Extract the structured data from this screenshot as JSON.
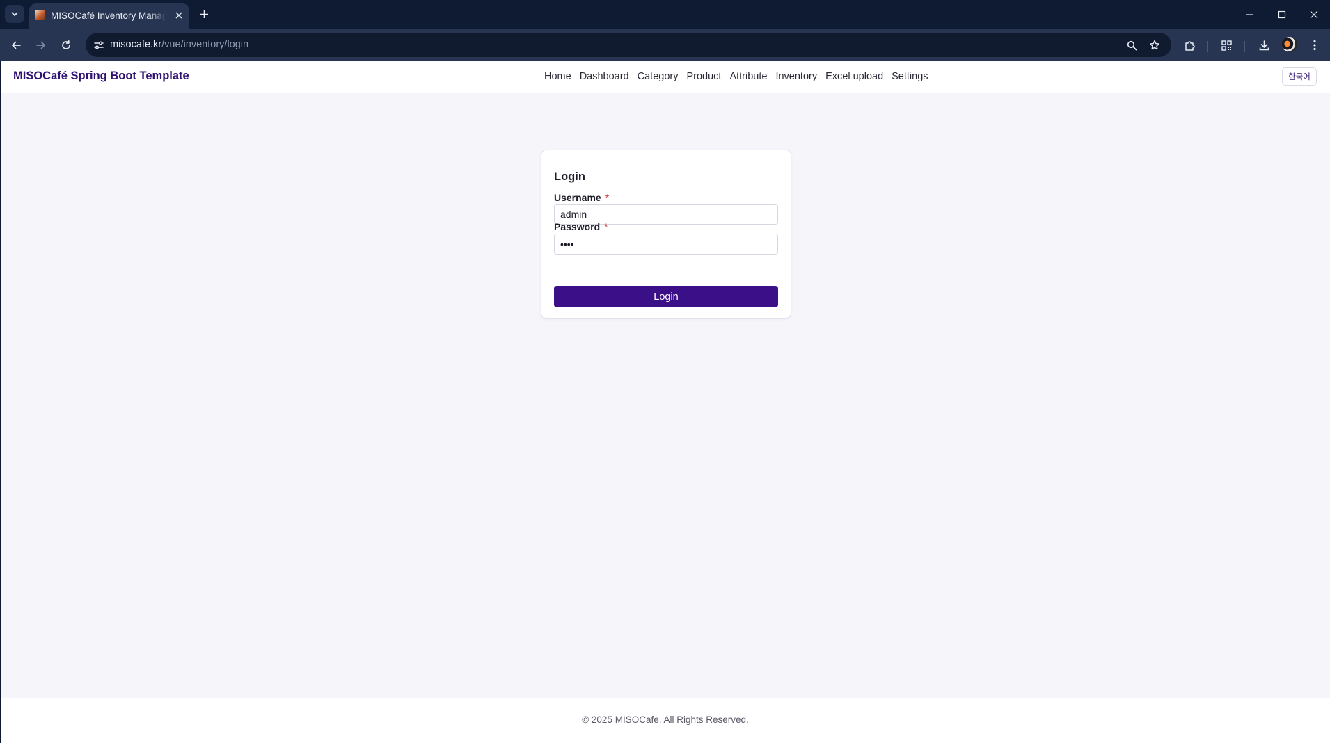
{
  "browser": {
    "tab_title": "MISOCafé Inventory Management",
    "url_host": "misocafe.kr",
    "url_path": "/vue/inventory/login",
    "icons": [
      "tab-list-icon",
      "close-icon",
      "plus-icon",
      "minimize-icon",
      "maximize-icon",
      "close-window-icon",
      "back-icon",
      "forward-icon",
      "reload-icon",
      "site-info-icon",
      "zoom-icon",
      "star-icon",
      "extensions-icon",
      "qr-icon",
      "download-icon",
      "profile-avatar",
      "kebab-menu-icon"
    ]
  },
  "header": {
    "brand": "MISOCafé Spring Boot Template",
    "nav": [
      "Home",
      "Dashboard",
      "Category",
      "Product",
      "Attribute",
      "Inventory",
      "Excel upload",
      "Settings"
    ],
    "language_button": "한국어"
  },
  "login": {
    "title": "Login",
    "username_label": "Username",
    "username_value": "admin",
    "password_label": "Password",
    "password_value": "••••",
    "required_mark": "*",
    "submit_label": "Login"
  },
  "footer": {
    "copyright": "© 2025 MISOCafe. All Rights Reserved."
  },
  "colors": {
    "brand": "#2e1170",
    "primary_button": "#3a0f87",
    "required": "#d83a3a",
    "page_background": "#f6f5fa"
  }
}
